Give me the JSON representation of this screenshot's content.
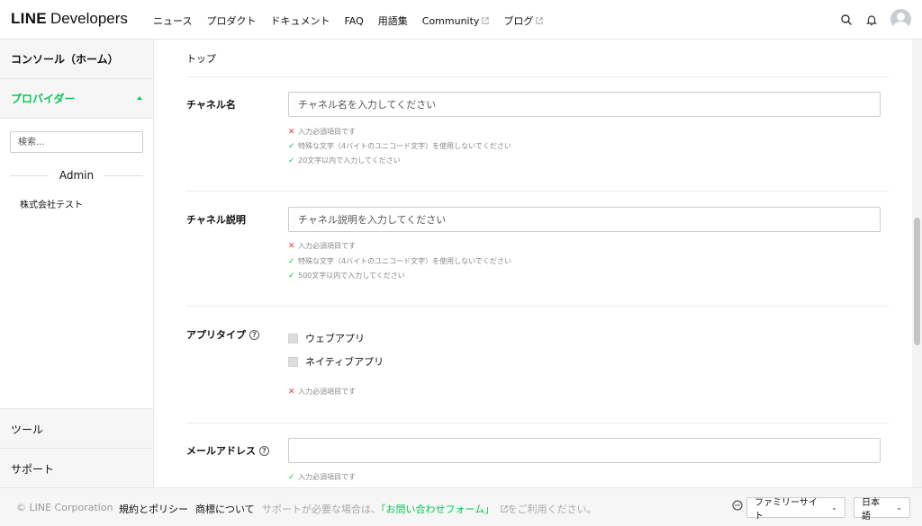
{
  "header": {
    "logo_bold": "LINE",
    "logo_regular": "Developers",
    "nav": [
      {
        "label": "ニュース",
        "external": false
      },
      {
        "label": "プロダクト",
        "external": false
      },
      {
        "label": "ドキュメント",
        "external": false
      },
      {
        "label": "FAQ",
        "external": false
      },
      {
        "label": "用語集",
        "external": false
      },
      {
        "label": "Community",
        "external": true
      },
      {
        "label": "ブログ",
        "external": true
      }
    ],
    "icons": [
      "search-icon",
      "bell-icon",
      "avatar"
    ]
  },
  "sidebar": {
    "console": "コンソール（ホーム）",
    "provider": "プロバイダー",
    "search_placeholder": "検索...",
    "group_label": "Admin",
    "company": "株式会社テスト",
    "tools": "ツール",
    "support": "サポート"
  },
  "main": {
    "breadcrumb": "トップ",
    "channel_name": {
      "label": "チャネル名",
      "placeholder": "チャネル名を入力してください",
      "validations": [
        {
          "ok": false,
          "text": "入力必須項目です"
        },
        {
          "ok": true,
          "text": "特殊な文字（4バイトのユニコード文字）を使用しないでください"
        },
        {
          "ok": true,
          "text": "20文字以内で入力してください"
        }
      ]
    },
    "channel_desc": {
      "label": "チャネル説明",
      "placeholder": "チャネル説明を入力してください",
      "validations": [
        {
          "ok": false,
          "text": "入力必須項目です"
        },
        {
          "ok": true,
          "text": "特殊な文字（4バイトのユニコード文字）を使用しないでください"
        },
        {
          "ok": true,
          "text": "500文字以内で入力してください"
        }
      ]
    },
    "app_type": {
      "label": "アプリタイプ",
      "options": [
        "ウェブアプリ",
        "ネイティブアプリ"
      ],
      "validation": "入力必須項目です"
    },
    "email": {
      "label": "メールアドレス",
      "value": "",
      "validation": "入力必須項目です"
    }
  },
  "footer": {
    "copyright": "© LINE Corporation",
    "terms": "規約とポリシー",
    "trademark": "商標について",
    "note_prefix": "サポートが必要な場合は、",
    "note_link": "「お問い合わせフォーム」",
    "note_suffix": "をご利用ください。",
    "family_site": "ファミリーサイト",
    "language": "日本語"
  },
  "colors": {
    "accent": "#06c755",
    "error": "#e53935"
  }
}
